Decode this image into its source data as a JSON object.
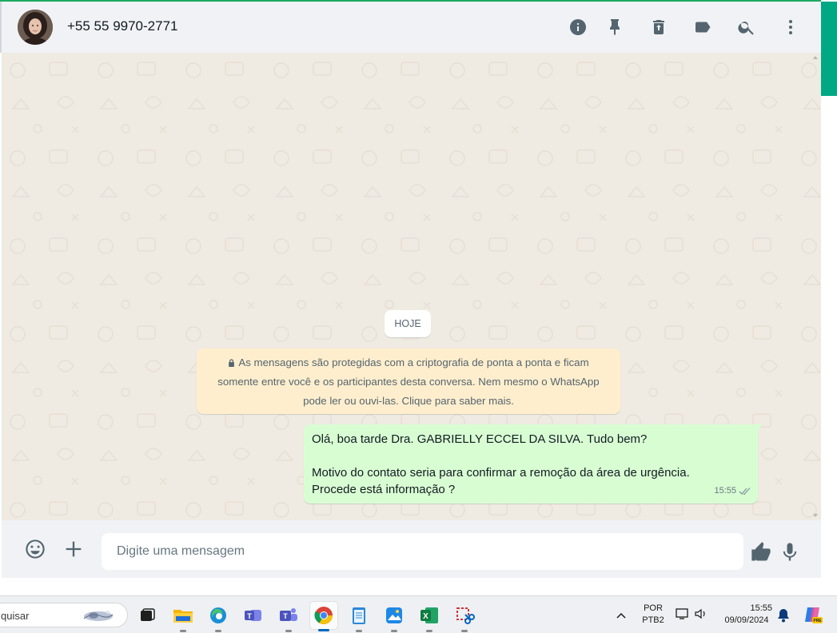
{
  "header": {
    "contact_name": "+55 55 9970-2771",
    "icons": [
      "info-icon",
      "pin-icon",
      "delete-icon",
      "label-icon",
      "search-icon",
      "menu-icon"
    ]
  },
  "chat": {
    "date_label": "HOJE",
    "encryption_notice": "As mensagens são protegidas com a criptografia de ponta a ponta e ficam somente entre você e os participantes desta conversa. Nem mesmo o WhatsApp pode ler ou ouvi-las. Clique para saber mais.",
    "messages": [
      {
        "direction": "outgoing",
        "line1": "Olá, boa tarde Dra. GABRIELLY ECCEL DA SILVA. Tudo bem?",
        "line2": "Motivo do contato seria para confirmar a remoção da área de urgência.",
        "line3": "Procede está informação ?",
        "time": "15:55",
        "status": "read"
      }
    ]
  },
  "footer": {
    "placeholder": "Digite uma mensagem"
  },
  "taskbar": {
    "search_text": "quisar",
    "language": "POR",
    "layout": "PTB2",
    "time": "15:55",
    "date": "09/09/2024",
    "apps": [
      "task-view",
      "file-explorer",
      "edge",
      "teams-work",
      "teams",
      "chrome",
      "notepad",
      "photos",
      "excel",
      "snipping-tool"
    ],
    "active_app": "chrome"
  },
  "colors": {
    "accent": "#00a884",
    "bubble_out": "#d9fdd3",
    "notice_bg": "#ffeecd",
    "chat_bg": "#efeae2"
  }
}
